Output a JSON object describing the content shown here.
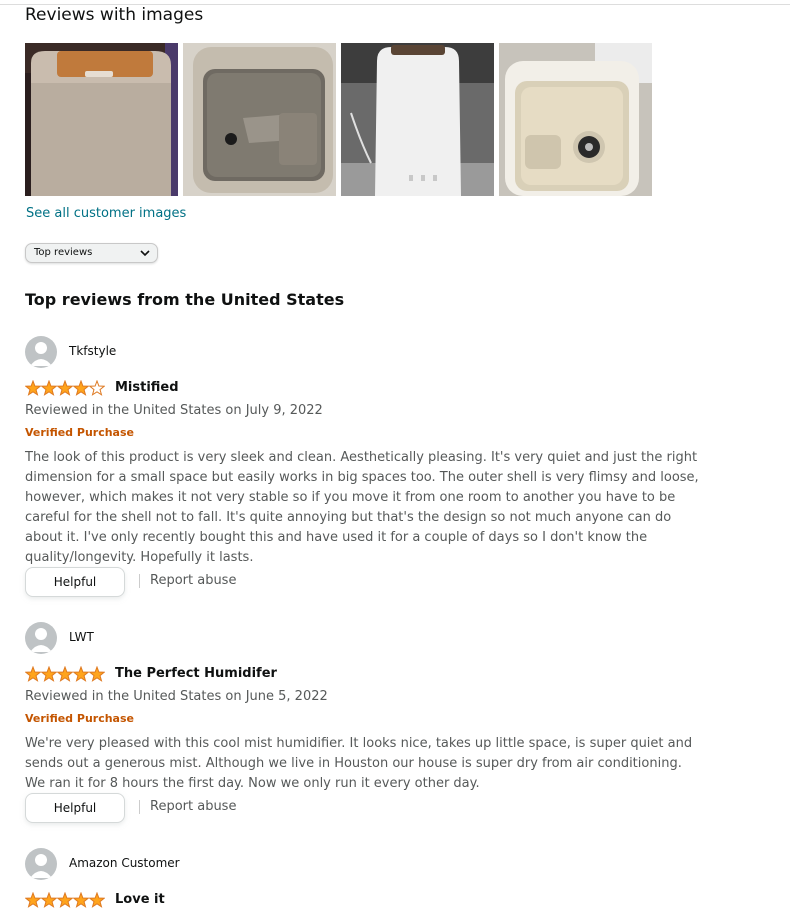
{
  "images_section": {
    "heading": "Reviews with images",
    "see_all_link": "See all customer images",
    "thumbnails": [
      {
        "icon": "humidifier-photo-wood-top"
      },
      {
        "icon": "humidifier-photo-open-tank"
      },
      {
        "icon": "humidifier-photo-white-body"
      },
      {
        "icon": "humidifier-photo-tank-interior"
      }
    ]
  },
  "sort": {
    "selected": "Top reviews",
    "icon": "chevron-down-icon"
  },
  "top_reviews_heading": "Top reviews from the United States",
  "colors": {
    "star": "#ffa41c",
    "star_border": "#de7921",
    "link": "#007185",
    "verified": "#c45500",
    "muted": "#565959"
  },
  "reviews": [
    {
      "profile_name": "Tkfstyle",
      "rating": 4,
      "title": "Mistified",
      "date": "Reviewed in the United States on July 9, 2022",
      "badge": "Verified Purchase",
      "body": "The look of this product is very sleek and clean. Aesthetically pleasing. It's very quiet and just the right dimension for a small space but easily works in big spaces too. The outer shell is very flimsy and loose, however, which makes it not very stable so if you move it from one room to another you have to be careful for the shell not to fall. It's quite annoying but that's the design so not much anyone can do about it. I've only recently bought this and have used it for a couple of days so I don't know the quality/longevity. Hopefully it lasts.",
      "helpful_label": "Helpful",
      "report_label": "Report abuse"
    },
    {
      "profile_name": "LWT",
      "rating": 5,
      "title": "The Perfect Humidifer",
      "date": "Reviewed in the United States on June 5, 2022",
      "badge": "Verified Purchase",
      "body": "We're very pleased with this cool mist humidifier. It looks nice, takes up little space, is super quiet and sends out a generous mist. Although we live in Houston our house is super dry from air conditioning. We ran it for 8 hours the first day. Now we only run it every other day.",
      "helpful_label": "Helpful",
      "report_label": "Report abuse"
    },
    {
      "profile_name": "Amazon Customer",
      "rating": 5,
      "title": "Love it"
    }
  ]
}
